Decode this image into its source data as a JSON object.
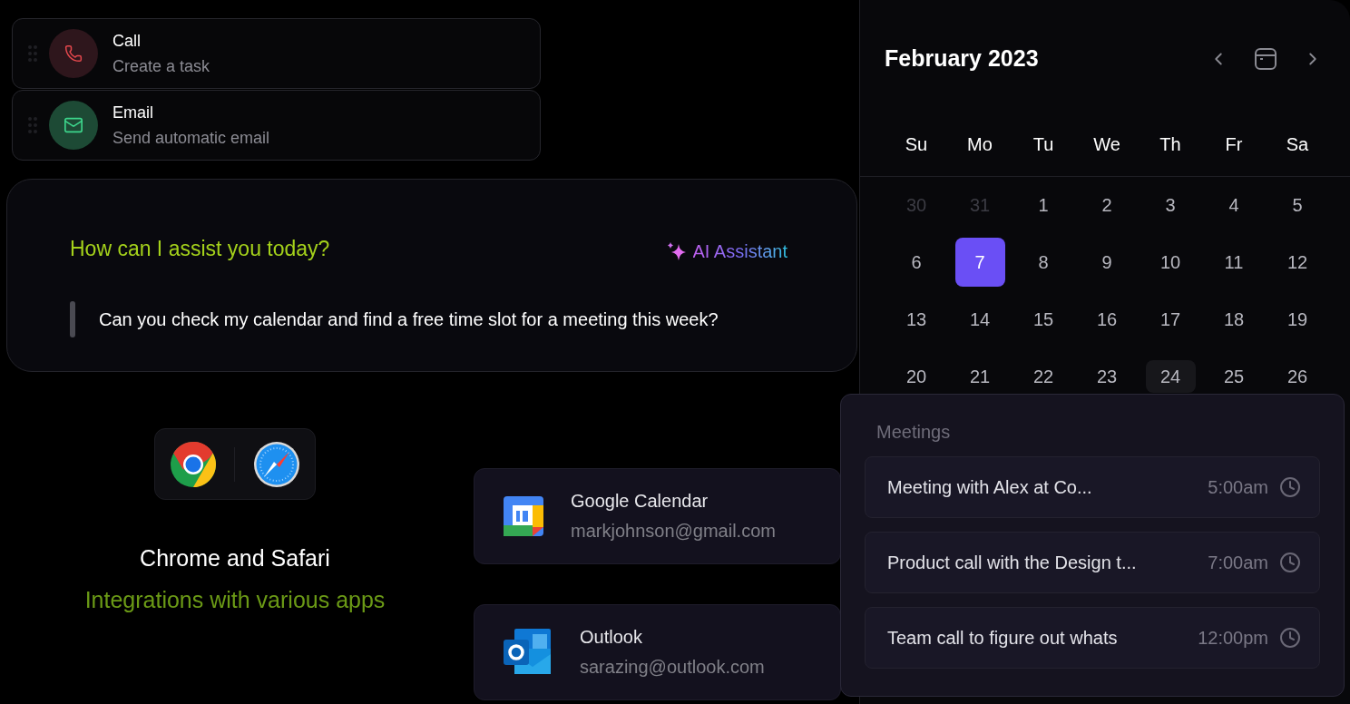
{
  "tasks": [
    {
      "kind": "call",
      "title": "Call",
      "subtitle": "Create a task"
    },
    {
      "kind": "email",
      "title": "Email",
      "subtitle": "Send automatic email"
    }
  ],
  "assistant": {
    "prompt": "How can I assist you today?",
    "badge": "AI Assistant",
    "message": "Can you check my calendar and find a free time slot for a meeting this week?"
  },
  "browsers": {
    "title": "Chrome and Safari",
    "subtitle": "Integrations with various apps"
  },
  "integrations": [
    {
      "kind": "google_calendar",
      "name": "Google Calendar",
      "email": "markjohnson@gmail.com"
    },
    {
      "kind": "outlook",
      "name": "Outlook",
      "email": "sarazing@outlook.com"
    }
  ],
  "calendar": {
    "title": "February 2023",
    "weekdays": [
      "Su",
      "Mo",
      "Tu",
      "We",
      "Th",
      "Fr",
      "Sa"
    ],
    "weeks": [
      [
        {
          "label": "30",
          "outside": true,
          "selected": false,
          "highlighted": false
        },
        {
          "label": "31",
          "outside": true,
          "selected": false,
          "highlighted": false
        },
        {
          "label": "1",
          "outside": false,
          "selected": false,
          "highlighted": false
        },
        {
          "label": "2",
          "outside": false,
          "selected": false,
          "highlighted": false
        },
        {
          "label": "3",
          "outside": false,
          "selected": false,
          "highlighted": false
        },
        {
          "label": "4",
          "outside": false,
          "selected": false,
          "highlighted": false
        },
        {
          "label": "5",
          "outside": false,
          "selected": false,
          "highlighted": false
        }
      ],
      [
        {
          "label": "6",
          "outside": false,
          "selected": false,
          "highlighted": false
        },
        {
          "label": "7",
          "outside": false,
          "selected": true,
          "highlighted": false
        },
        {
          "label": "8",
          "outside": false,
          "selected": false,
          "highlighted": false
        },
        {
          "label": "9",
          "outside": false,
          "selected": false,
          "highlighted": false
        },
        {
          "label": "10",
          "outside": false,
          "selected": false,
          "highlighted": false
        },
        {
          "label": "11",
          "outside": false,
          "selected": false,
          "highlighted": false
        },
        {
          "label": "12",
          "outside": false,
          "selected": false,
          "highlighted": false
        }
      ],
      [
        {
          "label": "13",
          "outside": false,
          "selected": false,
          "highlighted": false
        },
        {
          "label": "14",
          "outside": false,
          "selected": false,
          "highlighted": false
        },
        {
          "label": "15",
          "outside": false,
          "selected": false,
          "highlighted": false
        },
        {
          "label": "16",
          "outside": false,
          "selected": false,
          "highlighted": false
        },
        {
          "label": "17",
          "outside": false,
          "selected": false,
          "highlighted": false
        },
        {
          "label": "18",
          "outside": false,
          "selected": false,
          "highlighted": false
        },
        {
          "label": "19",
          "outside": false,
          "selected": false,
          "highlighted": false
        }
      ],
      [
        {
          "label": "20",
          "outside": false,
          "selected": false,
          "highlighted": false
        },
        {
          "label": "21",
          "outside": false,
          "selected": false,
          "highlighted": false
        },
        {
          "label": "22",
          "outside": false,
          "selected": false,
          "highlighted": false
        },
        {
          "label": "23",
          "outside": false,
          "selected": false,
          "highlighted": false
        },
        {
          "label": "24",
          "outside": false,
          "selected": false,
          "highlighted": true
        },
        {
          "label": "25",
          "outside": false,
          "selected": false,
          "highlighted": false
        },
        {
          "label": "26",
          "outside": false,
          "selected": false,
          "highlighted": false
        }
      ]
    ]
  },
  "meetings": {
    "title": "Meetings",
    "items": [
      {
        "title": "Meeting with Alex at Co...",
        "time": "5:00am"
      },
      {
        "title": "Product call with the Design t...",
        "time": "7:00am"
      },
      {
        "title": "Team call to figure out whats",
        "time": "12:00pm"
      }
    ]
  }
}
